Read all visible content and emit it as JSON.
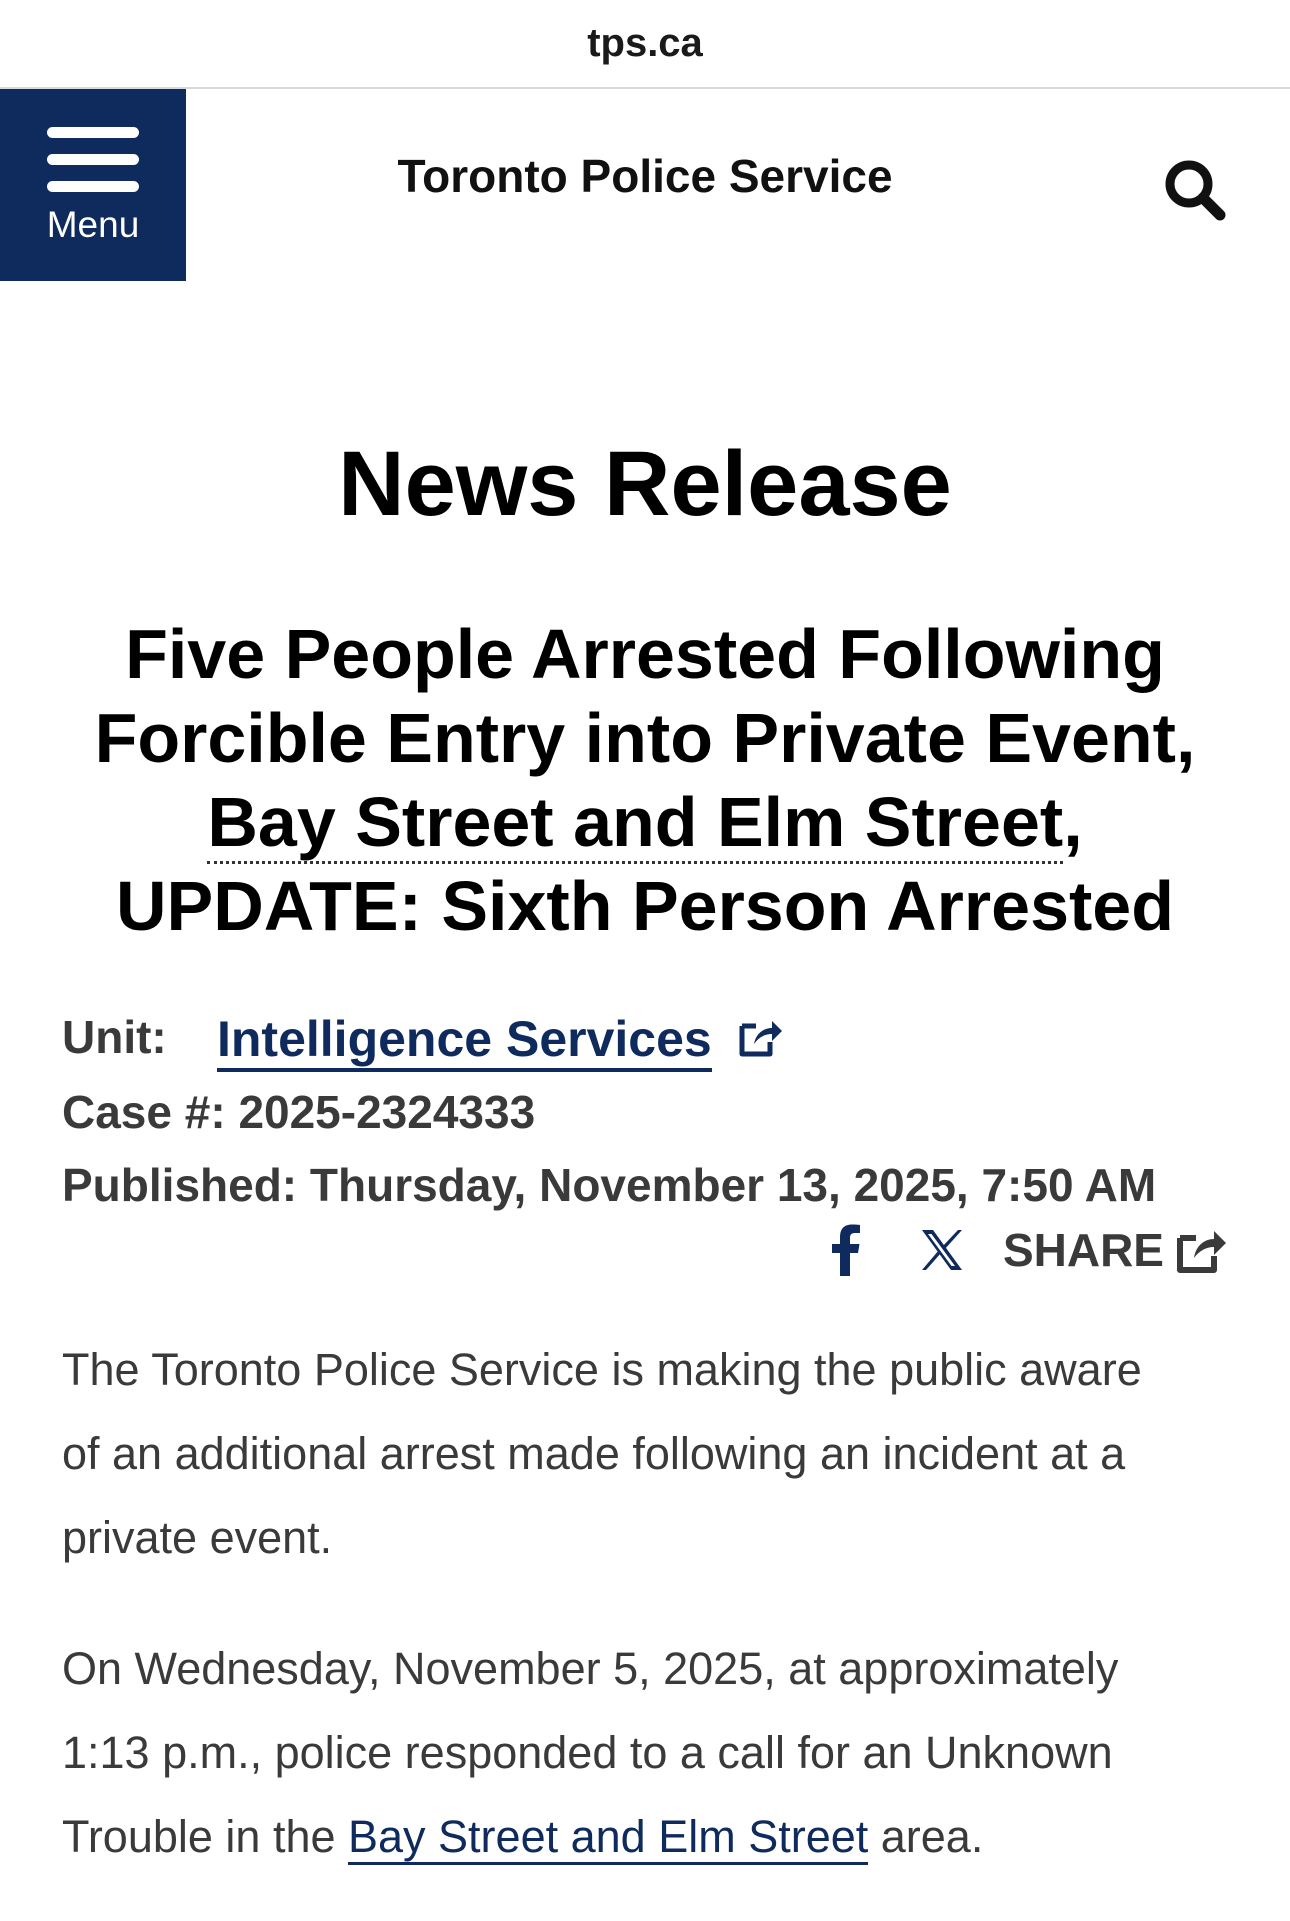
{
  "browser": {
    "url": "tps.ca"
  },
  "header": {
    "menu_label": "Menu",
    "site_title": "Toronto Police Service",
    "search_icon": "search-icon",
    "brand_color": "#0f2a5c"
  },
  "page": {
    "heading": "News Release",
    "title_lines": [
      "Five People Arrested Following",
      "Forcible Entry into Private Event,",
      "Bay Street and Elm Street",
      ",",
      "UPDATE: Sixth Person Arrested"
    ]
  },
  "meta": {
    "unit_label": "Unit:",
    "unit_value": "Intelligence Services",
    "case_label": "Case #:",
    "case_value": "2025-2324333",
    "published_label": "Published:",
    "published_value": "Thursday, November 13, 2025, 7:50 AM"
  },
  "share": {
    "facebook_icon": "facebook-icon",
    "x_icon": "x-icon",
    "label": "SHARE",
    "share_icon": "share-icon"
  },
  "body": {
    "paragraph_1": [
      "The Toronto Police Service is making the public aware",
      "of an additional arrest made following an incident at a",
      "private event."
    ],
    "paragraph_2": {
      "line_1": "On Wednesday, November 5, 2025, at approximately",
      "line_2": "1:13 p.m., police responded to a call for an Unknown",
      "line_3_before": "Trouble in the ",
      "line_3_link": "Bay Street and Elm Street",
      "line_3_after": " area."
    }
  }
}
